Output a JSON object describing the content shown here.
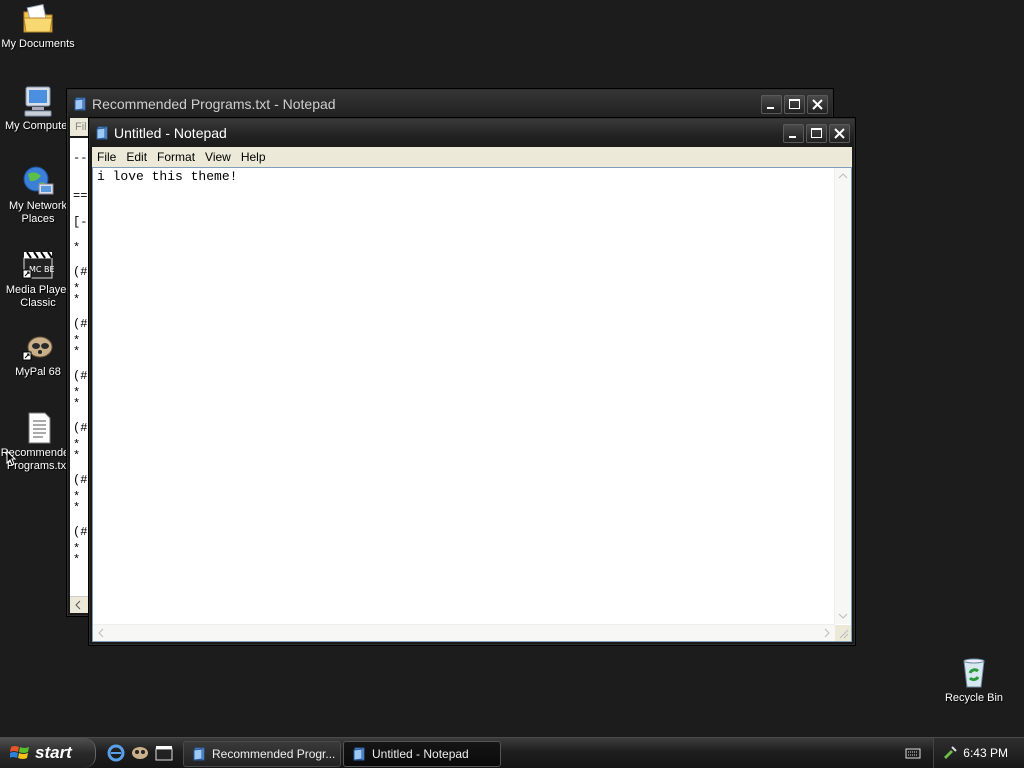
{
  "desktop": {
    "icons": [
      {
        "label": "My Documents",
        "icon": "my-documents-icon"
      },
      {
        "label": "My Computer",
        "icon": "my-computer-icon"
      },
      {
        "label": "My Network\nPlaces",
        "icon": "network-places-icon"
      },
      {
        "label": "Media Player\nClassic",
        "icon": "media-player-icon"
      },
      {
        "label": "MyPal 68",
        "icon": "mypal-icon"
      },
      {
        "label": "Recommended\nPrograms.txt",
        "icon": "text-file-icon"
      },
      {
        "label": "Recycle Bin",
        "icon": "recycle-bin-icon"
      }
    ]
  },
  "back_window": {
    "title": "Recommended Programs.txt - Notepad",
    "menu_first": "Fil",
    "line_fragments": [
      "--",
      "==",
      "[-",
      "*",
      "(#",
      "*",
      "*",
      "(#",
      "*",
      "*",
      "(#",
      "*",
      "*",
      "(#",
      "*",
      "*",
      "(#",
      "*",
      "*",
      "(#",
      "*",
      "*"
    ]
  },
  "front_window": {
    "title": "Untitled - Notepad",
    "menu": [
      "File",
      "Edit",
      "Format",
      "View",
      "Help"
    ],
    "content": "i love this theme!"
  },
  "taskbar": {
    "start_label": "start",
    "tasks": [
      {
        "label": "Recommended Progr..."
      },
      {
        "label": "Untitled - Notepad"
      }
    ],
    "clock": "6:43 PM"
  },
  "colors": {
    "desktop": "#1c1c1c",
    "menubar": "#ece9d8",
    "editor_border": "#7f9db9"
  }
}
